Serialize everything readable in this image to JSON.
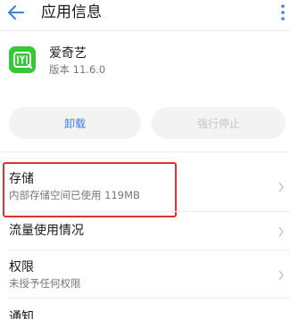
{
  "header": {
    "title": "应用信息",
    "back_icon": "arrow-left-icon",
    "more_icon": "more-vertical-icon"
  },
  "app": {
    "name": "爱奇艺",
    "version": "版本 11.6.0",
    "icon": "iqiyi-logo-icon",
    "icon_color": "#35c935"
  },
  "actions": {
    "uninstall_label": "卸载",
    "force_stop_label": "强行停止",
    "accent_color": "#3f7fd8"
  },
  "settings": [
    {
      "title": "存储",
      "subtitle": "内部存储空间已使用 119MB"
    },
    {
      "title": "流量使用情况",
      "subtitle": ""
    },
    {
      "title": "权限",
      "subtitle": "未授予任何权限"
    },
    {
      "title": "通知",
      "subtitle": ""
    }
  ],
  "highlight_color": "#d9352b"
}
